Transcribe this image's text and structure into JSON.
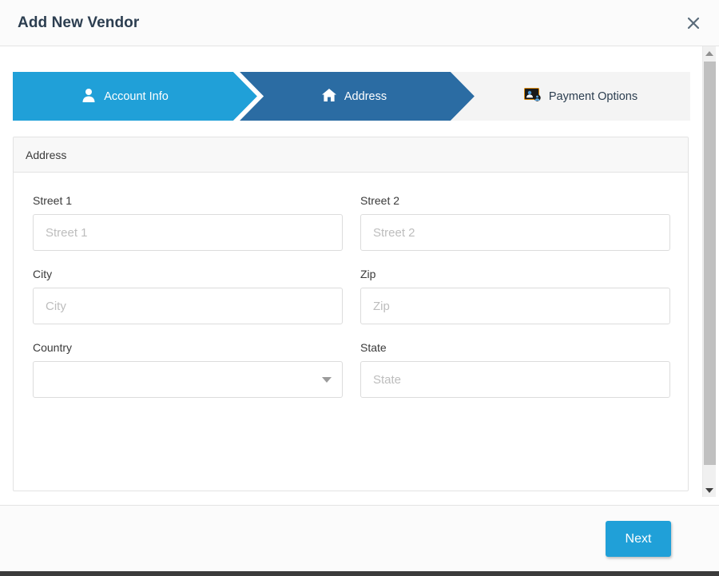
{
  "window": {
    "title": "Add New Vendor",
    "close_icon": "close-icon"
  },
  "wizard": {
    "steps": [
      {
        "label": "Account Info",
        "icon": "user-icon",
        "state": "completed"
      },
      {
        "label": "Address",
        "icon": "home-icon",
        "state": "active"
      },
      {
        "label": "Payment Options",
        "icon": "payment-card-icon",
        "state": "inactive"
      }
    ]
  },
  "panel": {
    "header_title": "Address",
    "fields": {
      "street1": {
        "label": "Street 1",
        "placeholder": "Street 1",
        "value": ""
      },
      "street2": {
        "label": "Street 2",
        "placeholder": "Street 2",
        "value": ""
      },
      "city": {
        "label": "City",
        "placeholder": "City",
        "value": ""
      },
      "zip": {
        "label": "Zip",
        "placeholder": "Zip",
        "value": ""
      },
      "country": {
        "label": "Country",
        "placeholder": "",
        "value": ""
      },
      "state": {
        "label": "State",
        "placeholder": "State",
        "value": ""
      }
    }
  },
  "footer": {
    "next_label": "Next"
  },
  "scrollbar": {
    "up_icon": "chevron-up-icon",
    "down_icon": "chevron-down-icon"
  },
  "colors": {
    "accent_light_blue": "#20a0d8",
    "accent_dark_blue": "#2b6ca3",
    "step_inactive_bg": "#f4f4f4",
    "title_text": "#2c3e50"
  }
}
